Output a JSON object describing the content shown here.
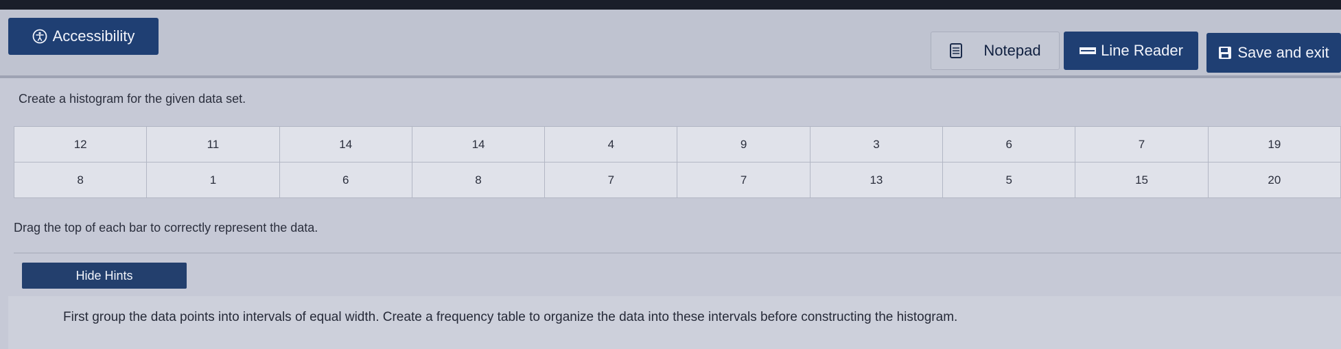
{
  "toolbar": {
    "accessibility_label": "Accessibility",
    "notepad_label": "Notepad",
    "line_reader_label": "Line Reader",
    "save_exit_label": "Save and exit"
  },
  "question": {
    "prompt": "Create a histogram for the given data set.",
    "data_rows": [
      [
        "12",
        "11",
        "14",
        "14",
        "4",
        "9",
        "3",
        "6",
        "7",
        "19"
      ],
      [
        "8",
        "1",
        "6",
        "8",
        "7",
        "7",
        "13",
        "5",
        "15",
        "20"
      ]
    ],
    "instruction": "Drag the top of each bar to correctly represent the data."
  },
  "hints": {
    "toggle_label": "Hide Hints",
    "text": "First group the data points into intervals of equal width. Create a frequency table to organize the data into these intervals before constructing the histogram."
  },
  "colors": {
    "button_blue": "#1f3f73",
    "background": "#c6c9d6"
  }
}
